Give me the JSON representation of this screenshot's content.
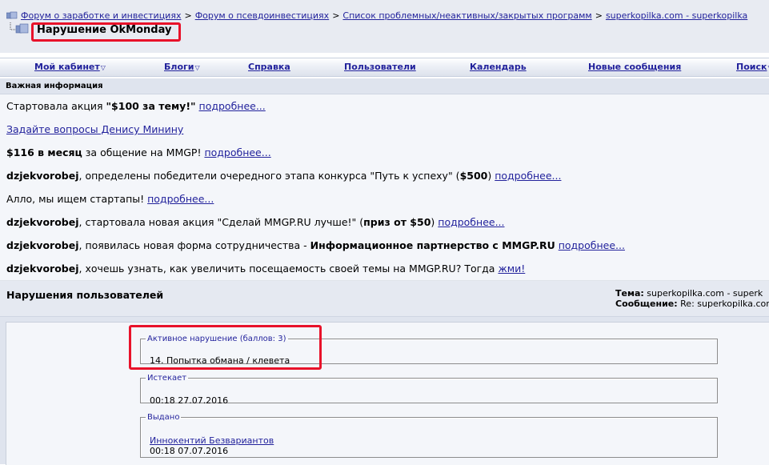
{
  "breadcrumbs": [
    "Форум о заработке и инвестициях",
    "Форум о псевдоинвестициях",
    "Список проблемных/неактивных/закрытых программ",
    "superkopilka.com - superkopilka"
  ],
  "breadcrumb_separator": ">",
  "page_title": "Нарушение OkMonday",
  "nav": {
    "items": [
      {
        "label": "Мой кабинет",
        "dropdown": true
      },
      {
        "label": "Блоги",
        "dropdown": true
      },
      {
        "label": "Справка",
        "dropdown": false
      },
      {
        "label": "Пользователи",
        "dropdown": false
      },
      {
        "label": "Календарь",
        "dropdown": false
      },
      {
        "label": "Новые сообщения",
        "dropdown": false
      },
      {
        "label": "Поиск",
        "dropdown": true
      }
    ],
    "dropdown_glyph": "▽"
  },
  "important": {
    "header": "Важная информация",
    "rows": [
      {
        "parts": [
          {
            "t": "Стартовала акция ",
            "s": "plain"
          },
          {
            "t": "\"$100 за тему!\"",
            "s": "bold"
          },
          {
            "t": " ",
            "s": "plain"
          },
          {
            "t": "подробнее...",
            "s": "link"
          }
        ]
      },
      {
        "parts": [
          {
            "t": "Задайте вопросы Денису Минину",
            "s": "link"
          }
        ]
      },
      {
        "parts": [
          {
            "t": "$116 в месяц",
            "s": "bold"
          },
          {
            "t": " за общение на MMGP! ",
            "s": "plain"
          },
          {
            "t": "подробнее...",
            "s": "link"
          }
        ]
      },
      {
        "parts": [
          {
            "t": "dzjekvorobej",
            "s": "bold"
          },
          {
            "t": ", определены победители очередного этапа конкурса \"Путь к успеху\" (",
            "s": "plain"
          },
          {
            "t": "$500",
            "s": "bold"
          },
          {
            "t": ") ",
            "s": "plain"
          },
          {
            "t": "подробнее...",
            "s": "link"
          }
        ]
      },
      {
        "parts": [
          {
            "t": "Алло, мы ищем стартапы! ",
            "s": "plain"
          },
          {
            "t": "подробнее...",
            "s": "link"
          }
        ]
      },
      {
        "parts": [
          {
            "t": "dzjekvorobej",
            "s": "bold"
          },
          {
            "t": ", стартовала новая акция \"Сделай MMGP.RU лучше!\" (",
            "s": "plain"
          },
          {
            "t": "приз от $50",
            "s": "bold"
          },
          {
            "t": ") ",
            "s": "plain"
          },
          {
            "t": "подробнее...",
            "s": "link"
          }
        ]
      },
      {
        "parts": [
          {
            "t": "dzjekvorobej",
            "s": "bold"
          },
          {
            "t": ", появилась новая форма сотрудничества - ",
            "s": "plain"
          },
          {
            "t": "Информационное партнерство с MMGP.RU",
            "s": "bold"
          },
          {
            "t": " ",
            "s": "plain"
          },
          {
            "t": "подробнее...",
            "s": "link"
          }
        ]
      },
      {
        "parts": [
          {
            "t": "dzjekvorobej",
            "s": "bold"
          },
          {
            "t": ", хочешь узнать, как увеличить посещаемость своей темы на MMGP.RU? Тогда ",
            "s": "plain"
          },
          {
            "t": "жми!",
            "s": "link"
          }
        ]
      }
    ]
  },
  "violations": {
    "title": "Нарушения пользователей",
    "theme_label": "Тема:",
    "theme_value": "superkopilka.com - superk",
    "message_label": "Сообщение:",
    "message_value": "Re: superkopilka.com"
  },
  "fields": {
    "active_legend": "Активное нарушение (баллов: 3)",
    "active_value": "14. Попытка обмана / клевета",
    "expires_legend": "Истекает",
    "expires_value": "00:18 27.07.2016",
    "issued_legend": "Выдано",
    "issued_by": "Иннокентий Безвариантов",
    "issued_value": "00:18 07.07.2016"
  },
  "colors": {
    "link": "#22229c",
    "highlight": "#e8122a",
    "band": "#e8ebf2",
    "row_bg": "#f4f6fa"
  }
}
